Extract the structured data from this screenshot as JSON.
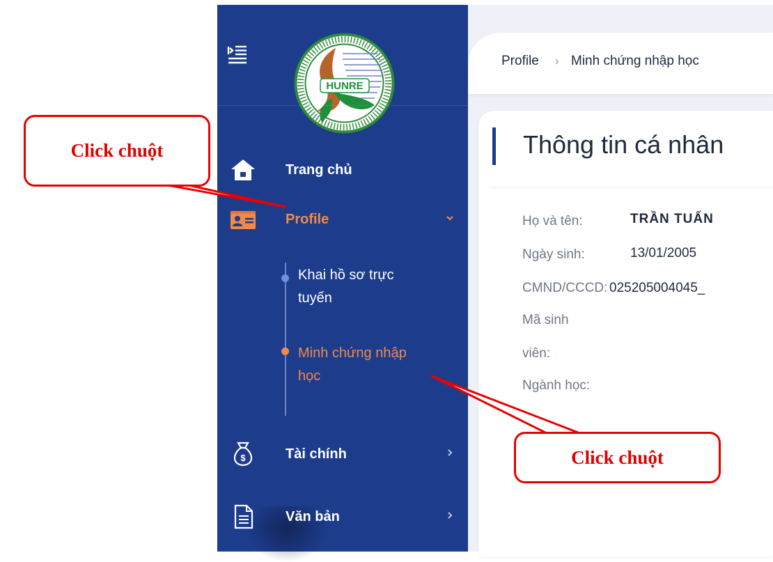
{
  "sidebar": {
    "items": [
      {
        "label": "Trang chủ",
        "icon": "home-icon"
      },
      {
        "label": "Profile",
        "icon": "id-card-icon",
        "expanded": true,
        "active": true,
        "sub_items": [
          {
            "label": "Khai hồ sơ trực tuyến",
            "line1": "Khai hồ sơ trực",
            "line2": "tuyến",
            "active": false
          },
          {
            "label": "Minh chứng nhập học",
            "line1": "Minh chứng nhập",
            "line2": "học",
            "active": true
          }
        ]
      },
      {
        "label": "Tài chính",
        "icon": "money-bag-icon"
      },
      {
        "label": "Văn bản",
        "icon": "document-icon"
      }
    ],
    "logo_text": "HUNRE"
  },
  "breadcrumb": [
    "Profile",
    "Minh chứng nhập học"
  ],
  "card": {
    "title": "Thông tin cá nhân",
    "fields": [
      {
        "label": "Họ và tên:",
        "value": "TRẦN TUẤN"
      },
      {
        "label": "Ngày sinh:",
        "value": "13/01/2005"
      },
      {
        "label": "CMND/CCCD:",
        "value": "025205004045_"
      },
      {
        "label": "Mã sinh",
        "label_cont": "viên:",
        "value": ""
      },
      {
        "label": "Ngành học:",
        "value": ""
      }
    ]
  },
  "callouts": [
    "Click chuột",
    "Click chuột"
  ],
  "colors": {
    "sidebar": "#1d3c8c",
    "accent": "#f08a4b",
    "callout": "#e00000"
  }
}
